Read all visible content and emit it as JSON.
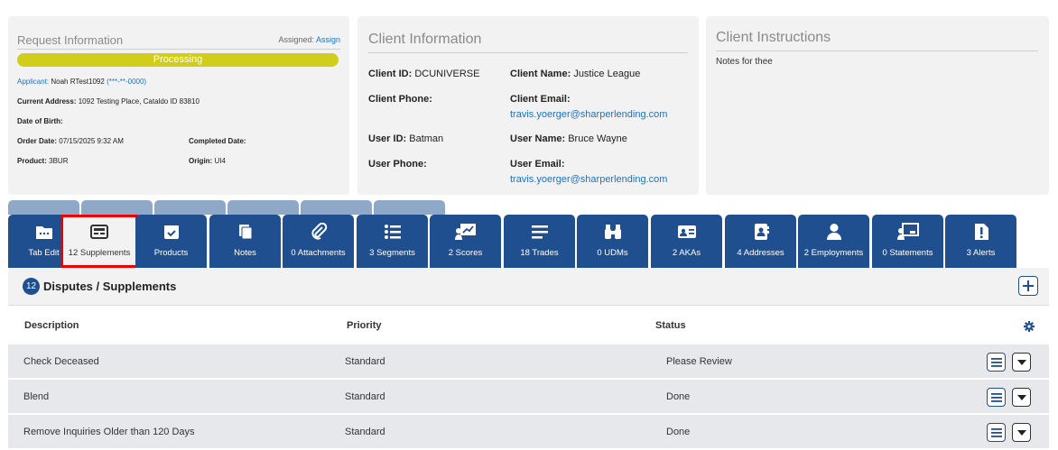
{
  "request": {
    "title": "Request Information",
    "assigned_label": "Assigned:",
    "assign_link": "Assign",
    "status": "Processing",
    "applicant_label": "Applicant:",
    "applicant_name": "Noah RTest1092",
    "applicant_ssn": "(***-**-0000)",
    "address_label": "Current Address:",
    "address": "1092 Testing Place, Cataldo ID 83810",
    "dob_label": "Date of Birth:",
    "order_date_label": "Order Date:",
    "order_date": "07/15/2025 9:32 AM",
    "completed_label": "Completed Date:",
    "product_label": "Product:",
    "product": "3BUR",
    "origin_label": "Origin:",
    "origin": "UI4"
  },
  "client": {
    "title": "Client Information",
    "client_id_label": "Client ID:",
    "client_id": "DCUNIVERSE",
    "client_name_label": "Client Name:",
    "client_name": "Justice League",
    "client_phone_label": "Client Phone:",
    "client_email_label": "Client Email:",
    "client_email": "travis.yoerger@sharperlending.com",
    "user_id_label": "User ID:",
    "user_id": "Batman",
    "user_name_label": "User Name:",
    "user_name": "Bruce Wayne",
    "user_phone_label": "User Phone:",
    "user_email_label": "User Email:",
    "user_email": "travis.yoerger@sharperlending.com"
  },
  "instructions": {
    "title": "Client Instructions",
    "note": "Notes for thee"
  },
  "tabs": [
    {
      "label": "Tab Edit",
      "icon": "folder-icon"
    },
    {
      "label": "12 Supplements",
      "icon": "supplements-icon"
    },
    {
      "label": "Products",
      "icon": "box-check-icon"
    },
    {
      "label": "Notes",
      "icon": "notes-icon"
    },
    {
      "label": "0 Attachments",
      "icon": "paperclip-icon"
    },
    {
      "label": "3 Segments",
      "icon": "list-icon"
    },
    {
      "label": "2 Scores",
      "icon": "chart-board-icon"
    },
    {
      "label": "18 Trades",
      "icon": "lines-icon"
    },
    {
      "label": "0 UDMs",
      "icon": "binoculars-icon"
    },
    {
      "label": "2 AKAs",
      "icon": "id-card-icon"
    },
    {
      "label": "4 Addresses",
      "icon": "address-book-icon"
    },
    {
      "label": "2 Employments",
      "icon": "person-icon"
    },
    {
      "label": "0 Statements",
      "icon": "board-icon"
    },
    {
      "label": "3 Alerts",
      "icon": "alert-file-icon"
    }
  ],
  "disputes": {
    "count": "12",
    "title": "Disputes / Supplements",
    "columns": {
      "description": "Description",
      "priority": "Priority",
      "status": "Status"
    },
    "rows": [
      {
        "description": "Check Deceased",
        "priority": "Standard",
        "status": "Please Review"
      },
      {
        "description": "Blend",
        "priority": "Standard",
        "status": "Done"
      },
      {
        "description": "Remove Inquiries Older than 120 Days",
        "priority": "Standard",
        "status": "Done"
      }
    ]
  },
  "colors": {
    "accent": "#1f4f8f",
    "processing": "#d1cd1b",
    "link": "#1a73c8",
    "highlight": "#e00000"
  }
}
